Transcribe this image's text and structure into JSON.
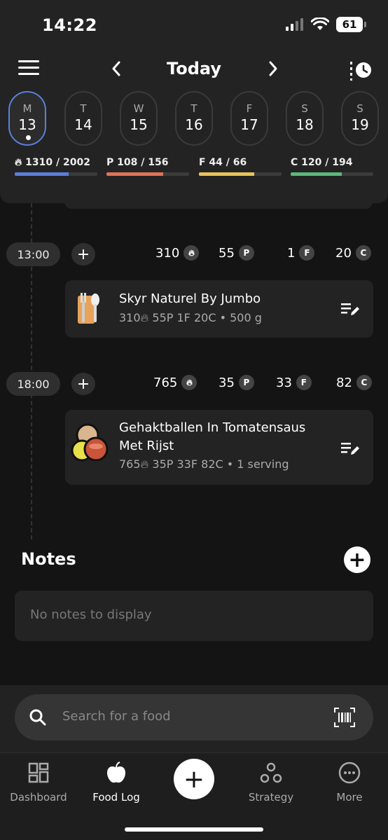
{
  "status": {
    "time": "14:22",
    "battery": "61"
  },
  "header": {
    "title": "Today"
  },
  "days": [
    {
      "letter": "M",
      "num": "13",
      "active": true
    },
    {
      "letter": "T",
      "num": "14"
    },
    {
      "letter": "W",
      "num": "15"
    },
    {
      "letter": "T",
      "num": "16"
    },
    {
      "letter": "F",
      "num": "17"
    },
    {
      "letter": "S",
      "num": "18"
    },
    {
      "letter": "S",
      "num": "19"
    }
  ],
  "macros": {
    "calories": {
      "label": "1310 / 2002",
      "progress": 0.65,
      "color": "#5b7fd9"
    },
    "protein": {
      "label": "P 108 / 156",
      "progress": 0.69,
      "color": "#e0735a"
    },
    "fat": {
      "label": "F 44 / 66",
      "progress": 0.67,
      "color": "#e8c35a"
    },
    "carbs": {
      "label": "C 120 / 194",
      "progress": 0.62,
      "color": "#5db87a"
    }
  },
  "meals": [
    {
      "time": "13:00",
      "totals": {
        "cal": "310",
        "p": "55",
        "f": "1",
        "c": "20"
      },
      "food": {
        "name": "Skyr Naturel By Jumbo",
        "cal": "310",
        "meta": "55P  1F  20C • 500 g"
      }
    },
    {
      "time": "18:00",
      "totals": {
        "cal": "765",
        "p": "35",
        "f": "33",
        "c": "82"
      },
      "food": {
        "name_line1": "Gehaktballen In Tomatensaus",
        "name_line2": "Met Rijst",
        "cal": "765",
        "meta": "35P  33F  82C • 1 serving"
      }
    }
  ],
  "badges": {
    "p": "P",
    "f": "F",
    "c": "C"
  },
  "notes": {
    "title": "Notes",
    "empty": "No notes to display"
  },
  "search": {
    "placeholder": "Search for a food"
  },
  "tabs": {
    "dashboard": "Dashboard",
    "foodlog": "Food Log",
    "strategy": "Strategy",
    "more": "More"
  },
  "colors": {
    "accent": "#5a7fd8",
    "background": "#141414",
    "card": "#232323"
  }
}
